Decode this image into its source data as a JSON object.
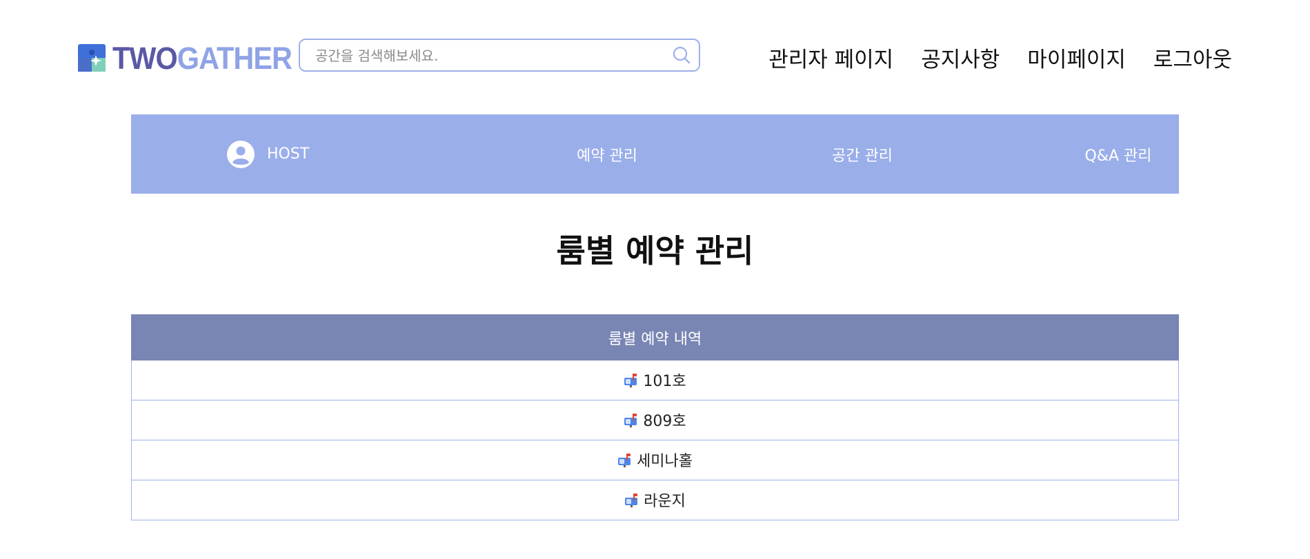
{
  "brand": {
    "name_part1": "TWO",
    "name_part2": "GATHER",
    "color_primary": "#5b58a6",
    "color_secondary": "#8fa3e6"
  },
  "search": {
    "placeholder": "공간을 검색해보세요.",
    "value": "",
    "icon": "search-icon"
  },
  "top_nav": {
    "admin": "관리자 페이지",
    "notice": "공지사항",
    "mypage": "마이페이지",
    "logout": "로그아웃"
  },
  "host_menu": {
    "profile_label": "HOST",
    "profile_icon": "user-circle-icon",
    "reservation": "예약 관리",
    "space": "공간 관리",
    "qna": "Q&A 관리",
    "background": "#9aaeea"
  },
  "page": {
    "title": "룸별 예약 관리"
  },
  "table": {
    "header": "룸별 예약 내역",
    "header_color": "#7986b3",
    "row_icon": "mailbox-icon",
    "rows": [
      {
        "label": "101호"
      },
      {
        "label": "809호"
      },
      {
        "label": "세미나홀"
      },
      {
        "label": "라운지"
      }
    ]
  }
}
